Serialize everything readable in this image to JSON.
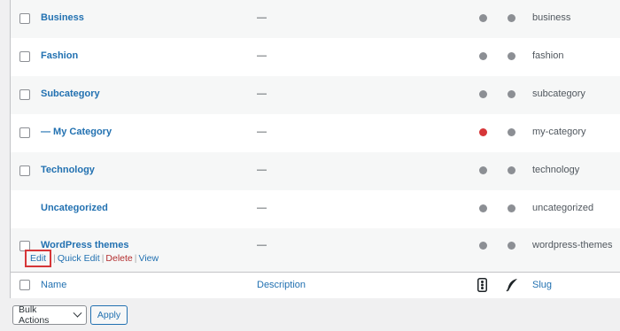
{
  "categories": [
    {
      "name": "Business",
      "description": "—",
      "slug": "business",
      "status_dot": "gray"
    },
    {
      "name": "Fashion",
      "description": "—",
      "slug": "fashion",
      "status_dot": "gray"
    },
    {
      "name": "Subcategory",
      "description": "—",
      "slug": "subcategory",
      "status_dot": "gray"
    },
    {
      "name": "— My Category",
      "description": "—",
      "slug": "my-category",
      "status_dot": "red"
    },
    {
      "name": "Technology",
      "description": "—",
      "slug": "technology",
      "status_dot": "gray"
    },
    {
      "name": "Uncategorized",
      "description": "—",
      "slug": "uncategorized",
      "status_dot": "gray"
    },
    {
      "name": "WordPress themes",
      "description": "—",
      "slug": "wordpress-themes",
      "status_dot": "gray"
    }
  ],
  "row_actions": {
    "edit": "Edit",
    "quick_edit": "Quick Edit",
    "delete": "Delete",
    "view": "View",
    "separator": "|"
  },
  "footer": {
    "name": "Name",
    "description": "Description",
    "slug": "Slug",
    "icon_col1": "traffic-light-icon",
    "icon_col2": "feather-icon"
  },
  "bulk_actions": {
    "selected": "Bulk Actions",
    "apply": "Apply"
  },
  "colors": {
    "link": "#2271b1",
    "delete": "#b32d2e",
    "dot_gray": "#8c8f94",
    "dot_red": "#d63638",
    "highlight_box": "#d63638"
  }
}
